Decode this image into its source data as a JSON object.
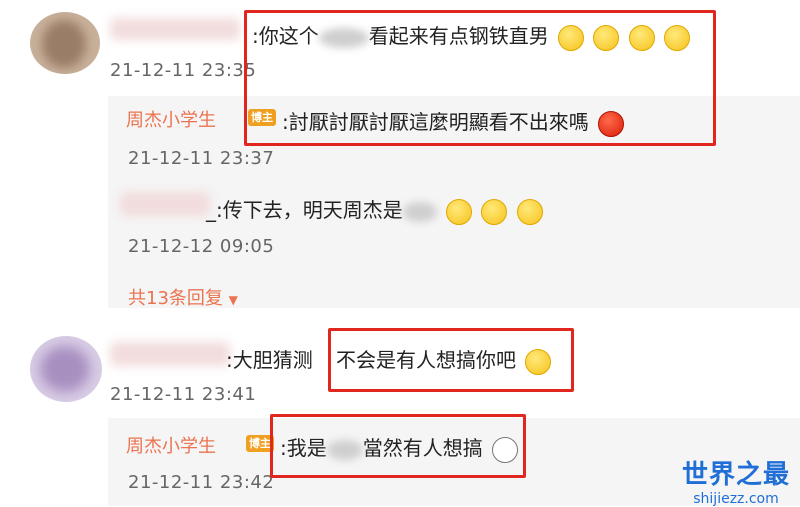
{
  "comments": [
    {
      "text": ":你这个",
      "text_after": "看起来有点钢铁直男",
      "time": "21-12-11 23:35",
      "emojis": [
        "smirk-face-icon",
        "smirk-face-icon",
        "smirk-face-icon",
        "smirk-face-icon"
      ]
    },
    {
      "text": "大胆猜测",
      "text_highlight": "不会是有人想搞你吧",
      "time": "21-12-11 23:41",
      "emojis": [
        "shocked-face-icon"
      ]
    }
  ],
  "replies": [
    {
      "author": "周杰小学生",
      "badge": "博主",
      "text": ":討厭討厭討厭這麼明顯看不出來嗎",
      "time": "21-12-11 23:37",
      "emojis": [
        "angry-face-icon"
      ]
    },
    {
      "text": "_:传下去，明天周杰是",
      "time": "21-12-12 09:05",
      "emojis": [
        "laugh-cry-icon",
        "laugh-cry-icon",
        "laugh-cry-icon"
      ]
    },
    {
      "author": "周杰小学生",
      "badge": "博主",
      "text": ":我是",
      "text_after": "當然有人想搞",
      "time": "21-12-11 23:42",
      "emojis": [
        "husky-dog-icon"
      ]
    }
  ],
  "more_replies": "共13条回复",
  "watermark": {
    "main": "世界之最",
    "sub": "shijiezz.com"
  },
  "colors": {
    "highlight": "#e0261e",
    "author": "#eb7350",
    "badge": "#f0a020",
    "logo": "#1f6fd6"
  }
}
